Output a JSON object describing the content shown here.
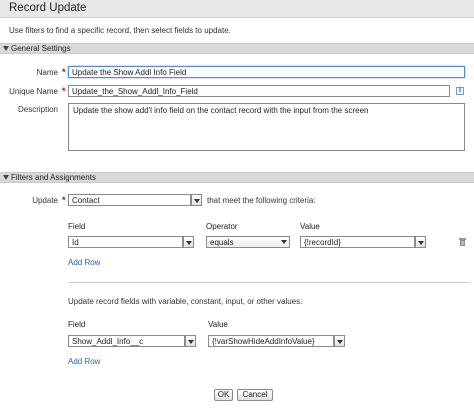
{
  "dialog": {
    "title": "Record Update",
    "intro": "Use filters to find a specific record, then select fields to update."
  },
  "general_settings": {
    "section_label": "General Settings",
    "name": {
      "label": "Name",
      "value": "Update the Show Addl Info Field"
    },
    "unique_name": {
      "label": "Unique Name",
      "value": "Update_the_Show_Addl_Info_Field"
    },
    "description": {
      "label": "Description",
      "value": "Update the show add'l info field on the contact record with the input from the screen"
    }
  },
  "filters": {
    "section_label": "Filters and Assignments",
    "update_label": "Update",
    "object_value": "Contact",
    "criteria_text": "that meet the following criteria:",
    "headers": {
      "field": "Field",
      "operator": "Operator",
      "value": "Value"
    },
    "rows": [
      {
        "field": "Id",
        "operator": "equals",
        "value": "{!recordId}"
      }
    ],
    "add_row": "Add Row"
  },
  "assignments": {
    "intro": "Update record fields with variable, constant, input, or other values.",
    "headers": {
      "field": "Field",
      "value": "Value"
    },
    "rows": [
      {
        "field": "Show_Addl_Info__c",
        "value": "{!varShowHideAddInfoValue}"
      }
    ],
    "add_row": "Add Row"
  },
  "buttons": {
    "ok": "OK",
    "cancel": "Cancel"
  }
}
